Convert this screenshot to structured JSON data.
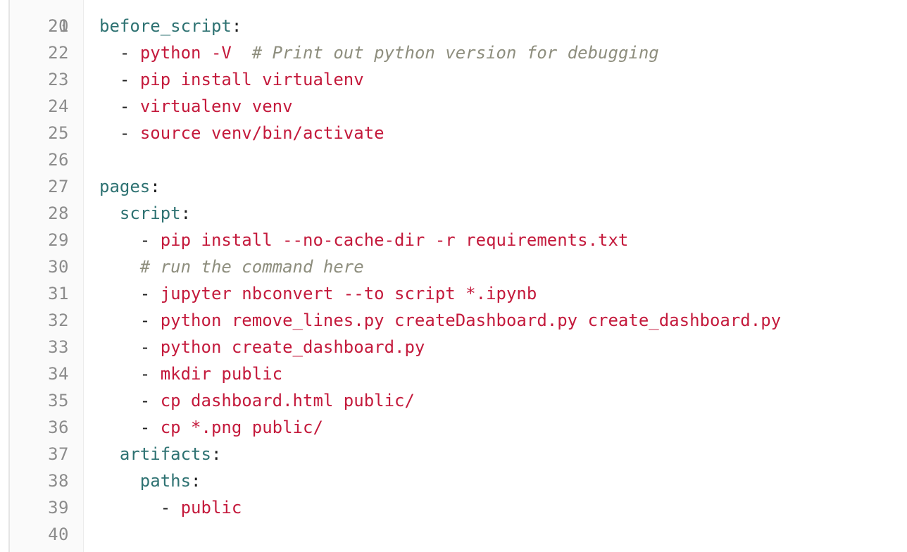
{
  "editor": {
    "language": "yaml",
    "top_partial_line_number": "20",
    "lines": [
      {
        "num": "21",
        "indent": "",
        "key": "before_script",
        "colon": ":"
      },
      {
        "num": "22",
        "indent": "  ",
        "dash": "-",
        "value": "python -V",
        "spacer": "  ",
        "comment": "# Print out python version for debugging"
      },
      {
        "num": "23",
        "indent": "  ",
        "dash": "-",
        "value": "pip install virtualenv"
      },
      {
        "num": "24",
        "indent": "  ",
        "dash": "-",
        "value": "virtualenv venv"
      },
      {
        "num": "25",
        "indent": "  ",
        "dash": "-",
        "value": "source venv/bin/activate"
      },
      {
        "num": "26",
        "indent": ""
      },
      {
        "num": "27",
        "indent": "",
        "key": "pages",
        "colon": ":"
      },
      {
        "num": "28",
        "indent": "  ",
        "key": "script",
        "colon": ":"
      },
      {
        "num": "29",
        "indent": "    ",
        "dash": "-",
        "value": "pip install --no-cache-dir -r requirements.txt"
      },
      {
        "num": "30",
        "indent": "    ",
        "comment": "# run the command here"
      },
      {
        "num": "31",
        "indent": "    ",
        "dash": "-",
        "value": "jupyter nbconvert --to script *.ipynb"
      },
      {
        "num": "32",
        "indent": "    ",
        "dash": "-",
        "value": "python remove_lines.py createDashboard.py create_dashboard.py"
      },
      {
        "num": "33",
        "indent": "    ",
        "dash": "-",
        "value": "python create_dashboard.py"
      },
      {
        "num": "34",
        "indent": "    ",
        "dash": "-",
        "value": "mkdir public"
      },
      {
        "num": "35",
        "indent": "    ",
        "dash": "-",
        "value": "cp dashboard.html public/"
      },
      {
        "num": "36",
        "indent": "    ",
        "dash": "-",
        "value": "cp *.png public/"
      },
      {
        "num": "37",
        "indent": "  ",
        "key": "artifacts",
        "colon": ":"
      },
      {
        "num": "38",
        "indent": "    ",
        "key": "paths",
        "colon": ":"
      },
      {
        "num": "39",
        "indent": "      ",
        "dash": "-",
        "value": "public"
      },
      {
        "num": "40",
        "indent": ""
      }
    ]
  },
  "colors": {
    "key": "#2e7272",
    "string": "#c41a3c",
    "comment": "#8e8e7e",
    "line_number": "#8c8c8c",
    "gutter_bg": "#fafafa"
  }
}
